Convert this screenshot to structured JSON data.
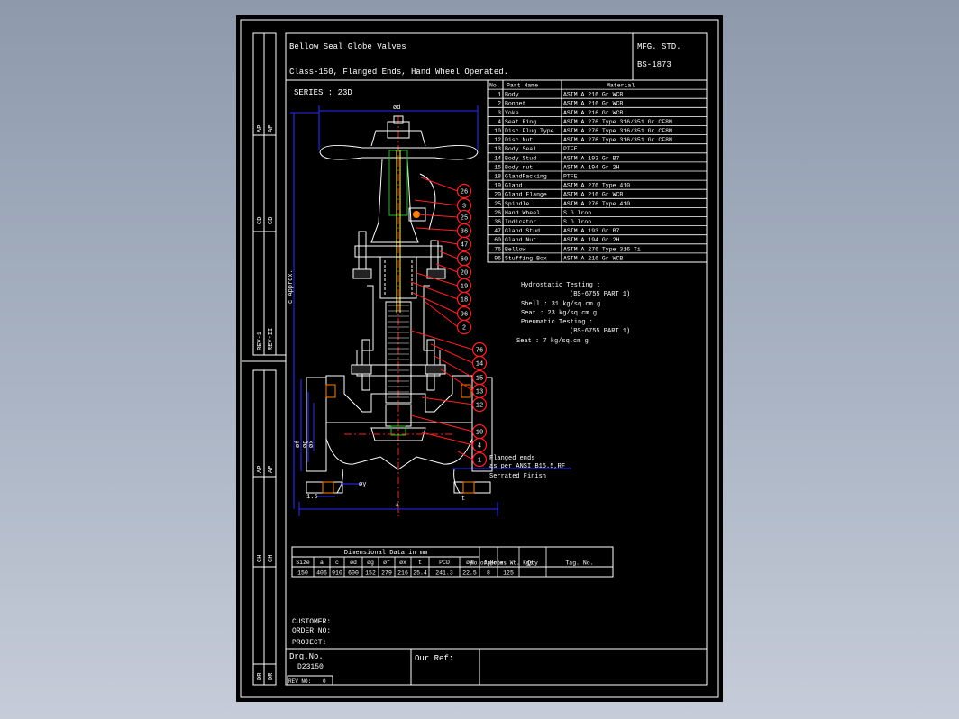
{
  "title": {
    "line1": "Bellow Seal Globe Valves",
    "line2": "Class-150, Flanged Ends, Hand Wheel Operated.",
    "mfg_label": "MFG. STD.",
    "mfg_std": "BS-1873",
    "series": "SERIES : 23D"
  },
  "parts_table": {
    "headers": [
      "No.",
      "Part Name",
      "Material"
    ],
    "rows": [
      [
        "1",
        "Body",
        "ASTM A 216 Gr WCB"
      ],
      [
        "2",
        "Bonnet",
        "ASTM A 216 Gr WCB"
      ],
      [
        "3",
        "Yoke",
        "ASTM A 216 Gr WCB"
      ],
      [
        "4",
        "Seat Ring",
        "ASTM A 276 Type 316/351 Gr CF8M"
      ],
      [
        "10",
        "Disc Plug Type",
        "ASTM A 276 Type 316/351 Gr CF8M"
      ],
      [
        "12",
        "Disc Nut",
        "ASTM A 276 Type 316/351 Gr CF8M"
      ],
      [
        "13",
        "Body Seal",
        "PTFE"
      ],
      [
        "14",
        "Body Stud",
        "ASTM A 193 Gr B7"
      ],
      [
        "15",
        "Body nut",
        "ASTM A 194 Gr 2H"
      ],
      [
        "18",
        "GlandPacking",
        "PTFE"
      ],
      [
        "19",
        "Gland",
        "ASTM A 276 Type 410"
      ],
      [
        "20",
        "Gland Flange",
        "ASTM A 216 Gr WCB"
      ],
      [
        "25",
        "Spindle",
        "ASTM A 276 Type 410"
      ],
      [
        "26",
        "Hand Wheel",
        "S.G.Iron"
      ],
      [
        "36",
        "Indicator",
        "S.G.Iron"
      ],
      [
        "47",
        "Gland Stud",
        "ASTM A 193 Gr B7"
      ],
      [
        "60",
        "Gland Nut",
        "ASTM A 194 Gr 2H"
      ],
      [
        "76",
        "Bellow",
        "ASTM A 276 Type 316 Ti"
      ],
      [
        "96",
        "Stuffing Box",
        "ASTM A 216 Gr WCB"
      ]
    ]
  },
  "testing": {
    "hydro_title": "Hydrostatic Testing :",
    "hydro_std": "(BS-6755 PART 1)",
    "shell": "Shell : 31 kg/sq.cm g",
    "seat": "Seat  : 23 kg/sq.cm g",
    "pneu_title": "Pneumatic Testing :",
    "pneu_std": "(BS-6755 PART 1)",
    "pneu_seat": "Seat : 7 kg/sq.cm g"
  },
  "flange_note": {
    "line1": "Flanged ends",
    "line2": "as per ANSI B16.5,RF",
    "line3": "Serrated Finish"
  },
  "callouts": [
    "26",
    "3",
    "25",
    "36",
    "47",
    "60",
    "20",
    "19",
    "18",
    "96",
    "2",
    "76",
    "14",
    "15",
    "13",
    "12",
    "10",
    "4",
    "1"
  ],
  "drawing_labels": {
    "od": "ød",
    "c_approx": "c Approx.",
    "of": "øf",
    "og": "øg",
    "ox": "øx",
    "oy": "øy",
    "bolt": "1.5",
    "t": "t",
    "a": "a"
  },
  "dim_table": {
    "title": "Dimensional Data in mm",
    "headers": [
      "Size",
      "a",
      "c",
      "ød",
      "øg",
      "øf",
      "øx",
      "t",
      "PCD",
      "øy"
    ],
    "values": [
      "150",
      "406",
      "910",
      "600",
      "152",
      "279",
      "216",
      "25.4",
      "241.3",
      "22.5"
    ],
    "no_holes_label": "No of Holes",
    "no_holes": "8",
    "wt_label": "Approx. Wt. Kgs",
    "wt": "125",
    "qty_label": "Qty",
    "tag_label": "Tag. No."
  },
  "customer": {
    "customer": "CUSTOMER:",
    "order": "ORDER NO:",
    "project": "PROJECT:"
  },
  "footer": {
    "drg_label": "Drg.No.",
    "drg_no": "D23150",
    "our_ref": "Our Ref:",
    "rev_no": "REV NO:",
    "rev_value": "0"
  },
  "side_strip": {
    "upper": [
      "AP",
      "CD",
      "REV-1"
    ],
    "upper_b": [
      "AP",
      "CD",
      "REV-II"
    ],
    "lower": [
      "AP",
      "CH",
      "DR"
    ],
    "lower_b": [
      "AP",
      "CH",
      "DR"
    ]
  },
  "colors": {
    "background": "#000000",
    "frame": "#ffffff",
    "body_lines": "#ffffff",
    "dimension_lines": "#2c2cff",
    "callout_lines": "#ff2020",
    "centerline": "#ff2020",
    "green_detail": "#20c020"
  }
}
